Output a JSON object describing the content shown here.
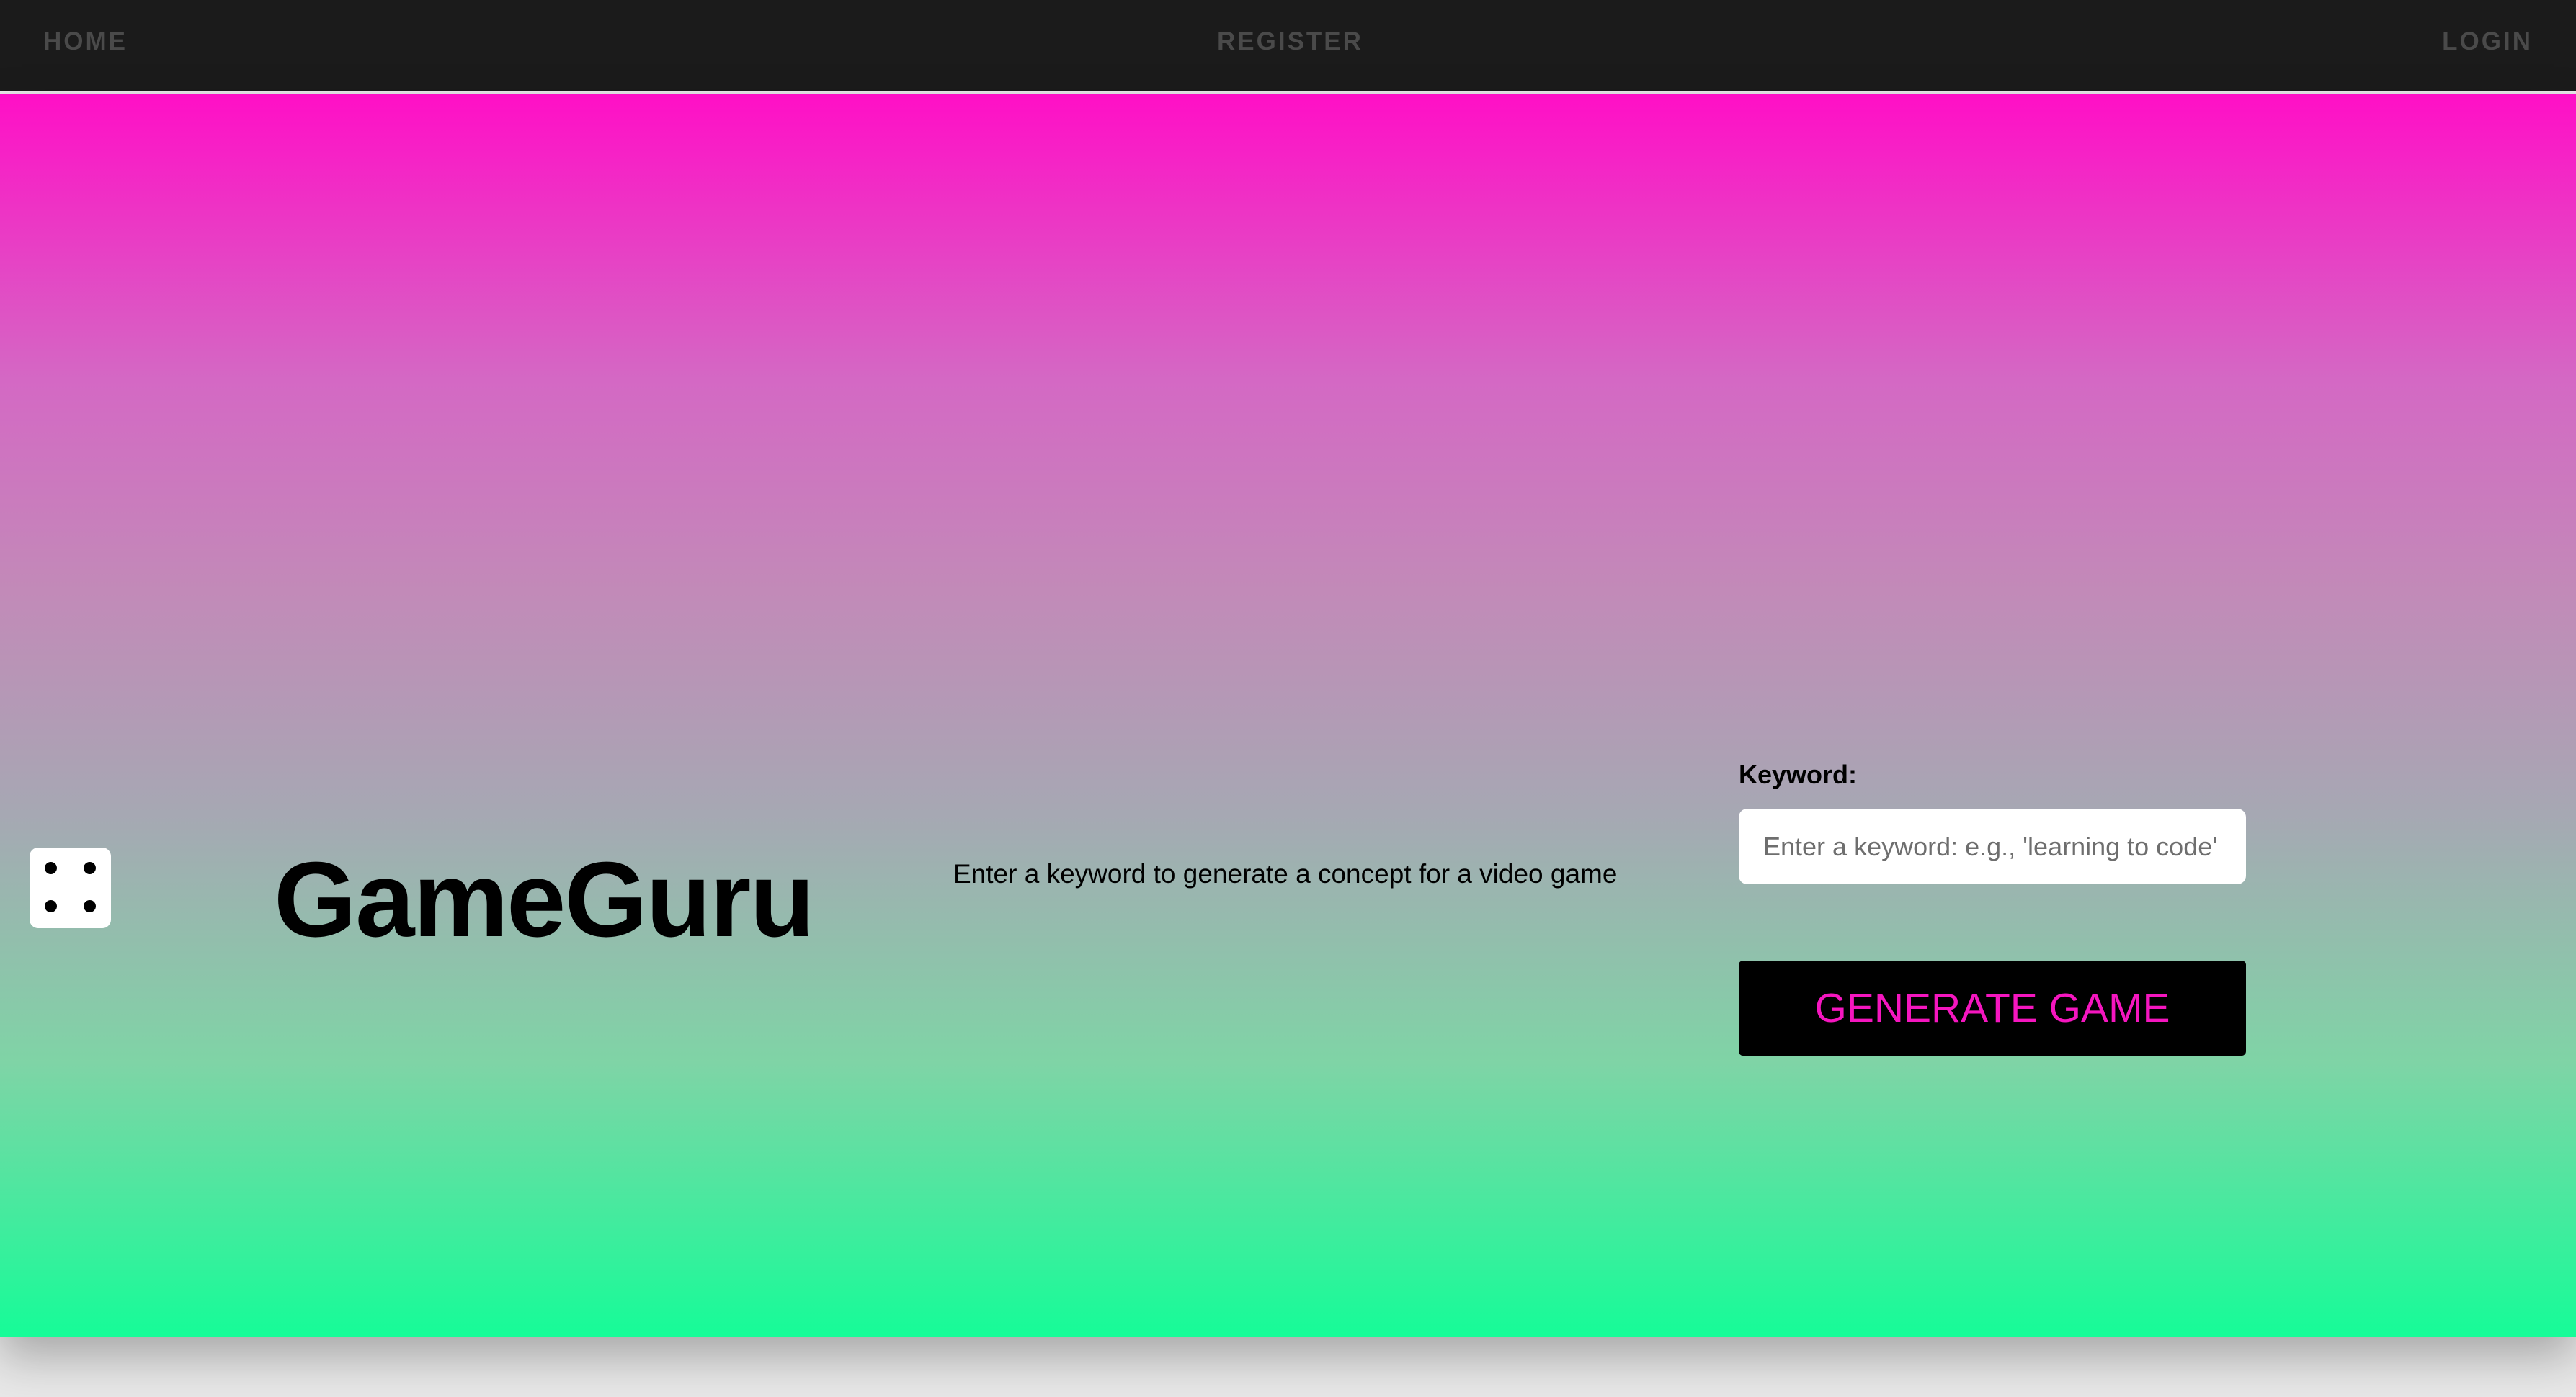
{
  "nav": {
    "home": "HOME",
    "register": "REGISTER",
    "login": "LOGIN"
  },
  "hero": {
    "title": "GameGuru",
    "tagline": "Enter a keyword to generate a concept for a video game",
    "dice_icon": "dice-four-icon"
  },
  "form": {
    "keyword_label": "Keyword:",
    "keyword_placeholder": "Enter a keyword: e.g., 'learning to code'",
    "keyword_value": "",
    "generate_label": "GENERATE GAME"
  },
  "colors": {
    "nav_background": "#1b1b1b",
    "gradient_top": "#ff0fc6",
    "gradient_bottom": "#16fc98",
    "button_background": "#000000",
    "button_text": "#f516bf"
  }
}
